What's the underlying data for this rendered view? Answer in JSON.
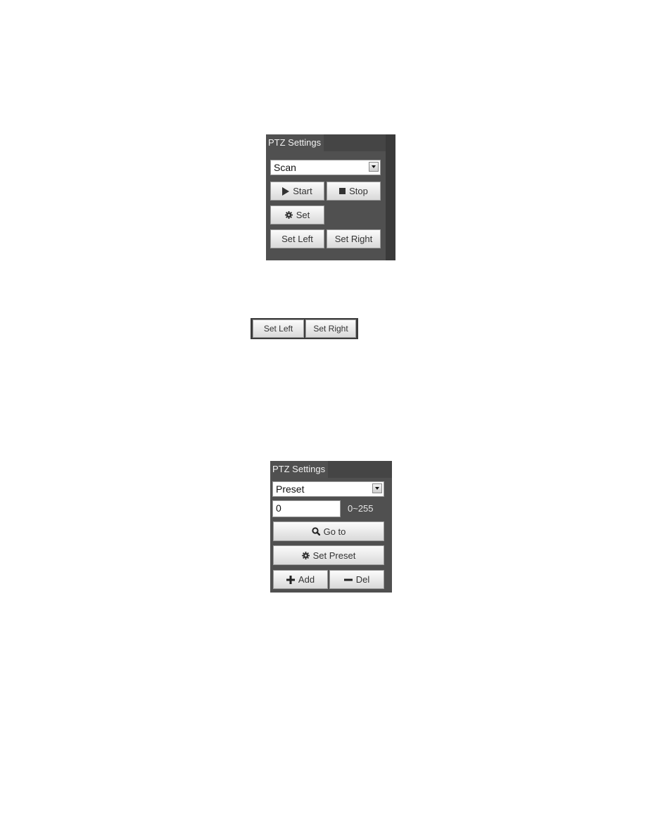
{
  "scan_panel": {
    "tab_title": "PTZ Settings",
    "mode_select": {
      "value": "Scan"
    },
    "buttons": {
      "start": "Start",
      "stop": "Stop",
      "set": "Set",
      "set_left": "Set Left",
      "set_right": "Set Right"
    },
    "icons": {
      "start": "play-icon",
      "stop": "stop-icon",
      "set": "gear-icon"
    }
  },
  "left_right_strip": {
    "buttons": {
      "set_left": "Set Left",
      "set_right": "Set Right"
    }
  },
  "preset_panel": {
    "tab_title": "PTZ Settings",
    "mode_select": {
      "value": "Preset"
    },
    "preset_input": {
      "value": "0"
    },
    "range_label": "0~255",
    "buttons": {
      "go_to": "Go to",
      "set_preset": "Set Preset",
      "add": "Add",
      "del": "Del"
    },
    "icons": {
      "go_to": "search-icon",
      "set_preset": "gear-icon",
      "add": "plus-icon",
      "del": "minus-icon"
    }
  }
}
